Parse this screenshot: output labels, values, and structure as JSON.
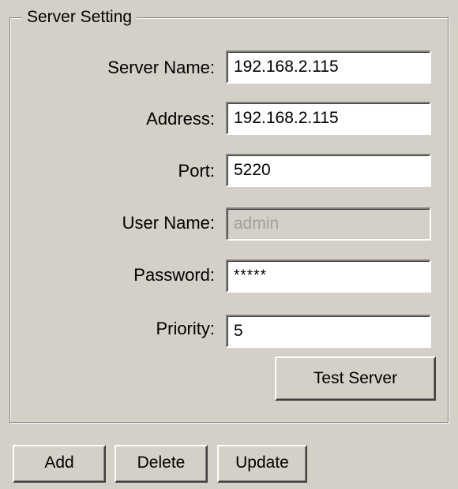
{
  "group": {
    "title": "Server Setting"
  },
  "fields": {
    "server_name": {
      "label": "Server Name:",
      "value": "192.168.2.115"
    },
    "address": {
      "label": "Address:",
      "value": "192.168.2.115"
    },
    "port": {
      "label": "Port:",
      "value": "5220"
    },
    "user_name": {
      "label": "User Name:",
      "value": "admin",
      "disabled": true
    },
    "password": {
      "label": "Password:",
      "value": "*****"
    },
    "priority": {
      "label": "Priority:",
      "value": "5"
    }
  },
  "buttons": {
    "test_server": "Test Server",
    "add": "Add",
    "delete": "Delete",
    "update": "Update"
  }
}
